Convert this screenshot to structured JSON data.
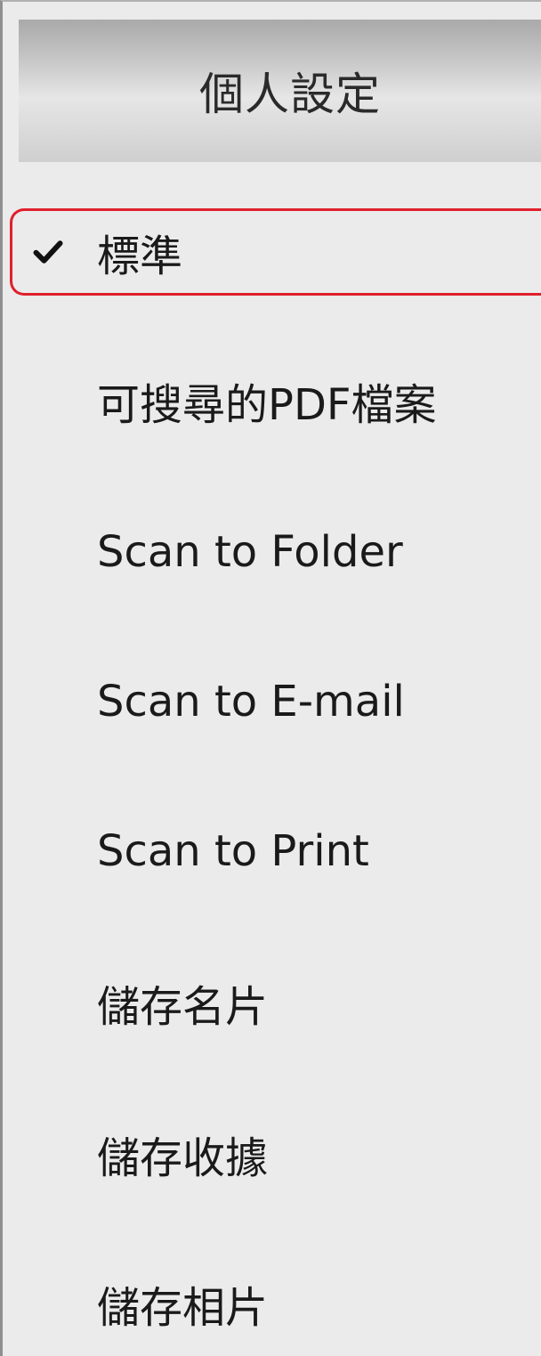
{
  "menu": {
    "header": "個人設定",
    "items": [
      {
        "label": "標準",
        "checked": true
      },
      {
        "label": "可搜尋的PDF檔案",
        "checked": false
      },
      {
        "label": "Scan to Folder",
        "checked": false
      },
      {
        "label": "Scan to E-mail",
        "checked": false
      },
      {
        "label": "Scan to Print",
        "checked": false
      },
      {
        "label": "儲存名片",
        "checked": false
      },
      {
        "label": "儲存收據",
        "checked": false
      },
      {
        "label": "儲存相片",
        "checked": false
      }
    ]
  },
  "colors": {
    "menu_background": "#ebebeb",
    "selection_outline": "#e0202c"
  }
}
